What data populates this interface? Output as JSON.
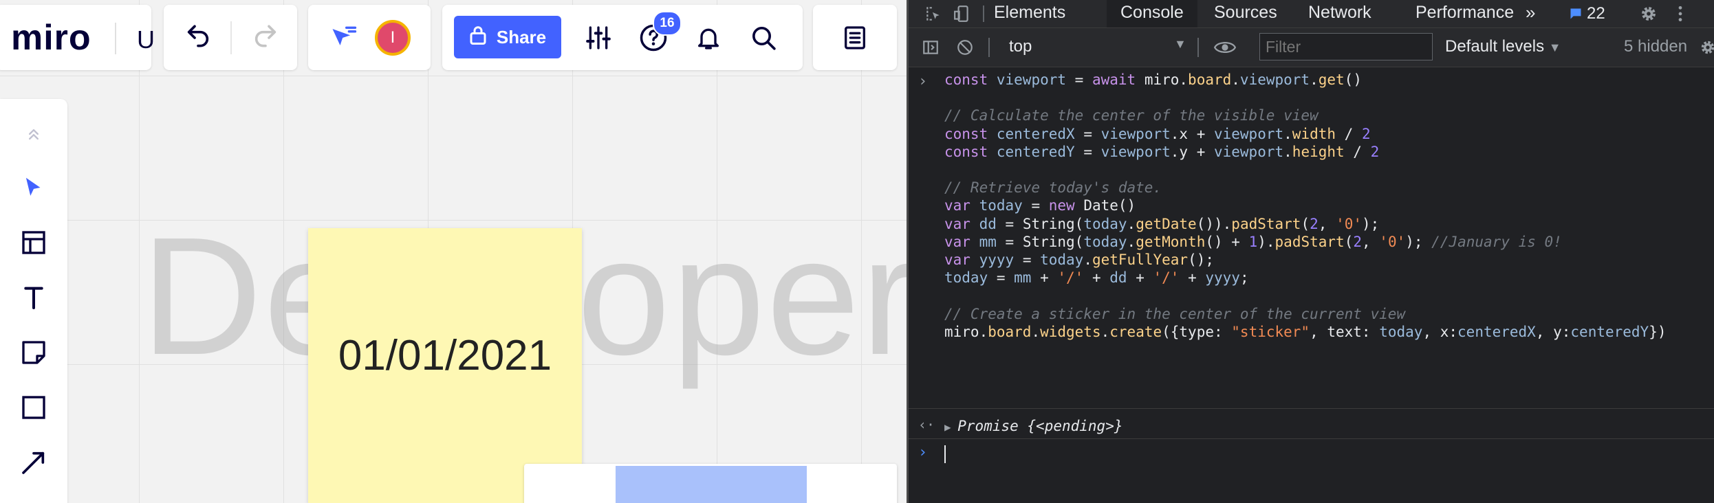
{
  "board": {
    "logo": "miro",
    "board_name": "U",
    "share_label": "Share",
    "notification_count": "16",
    "avatar_initial": "I",
    "background_word": "Developer",
    "sticker_text": "01/01/2021",
    "colors": {
      "accent": "#4262ff",
      "sticker": "#fef8b4",
      "avatar": "#e0496b"
    }
  },
  "devtools": {
    "tabs": [
      "Elements",
      "Console",
      "Sources",
      "Network",
      "Performance"
    ],
    "active_tab": "Console",
    "message_count": "22",
    "context": "top",
    "filter_placeholder": "Filter",
    "levels": "Default levels",
    "hidden_count": "5 hidden",
    "result": "Promise {<pending>}",
    "code_lines": [
      "const viewport = await miro.board.viewport.get()",
      "",
      "// Calculate the center of the visible view",
      "const centeredX = viewport.x + viewport.width / 2",
      "const centeredY = viewport.y + viewport.height / 2",
      "",
      "// Retrieve today's date.",
      "var today = new Date()",
      "var dd = String(today.getDate()).padStart(2, '0');",
      "var mm = String(today.getMonth() + 1).padStart(2, '0'); //January is 0!",
      "var yyyy = today.getFullYear();",
      "today = mm + '/' + dd + '/' + yyyy;",
      "",
      "// Create a sticker in the center of the current view",
      "miro.board.widgets.create({type: \"sticker\", text: today, x:centeredX, y:centeredY})"
    ]
  }
}
